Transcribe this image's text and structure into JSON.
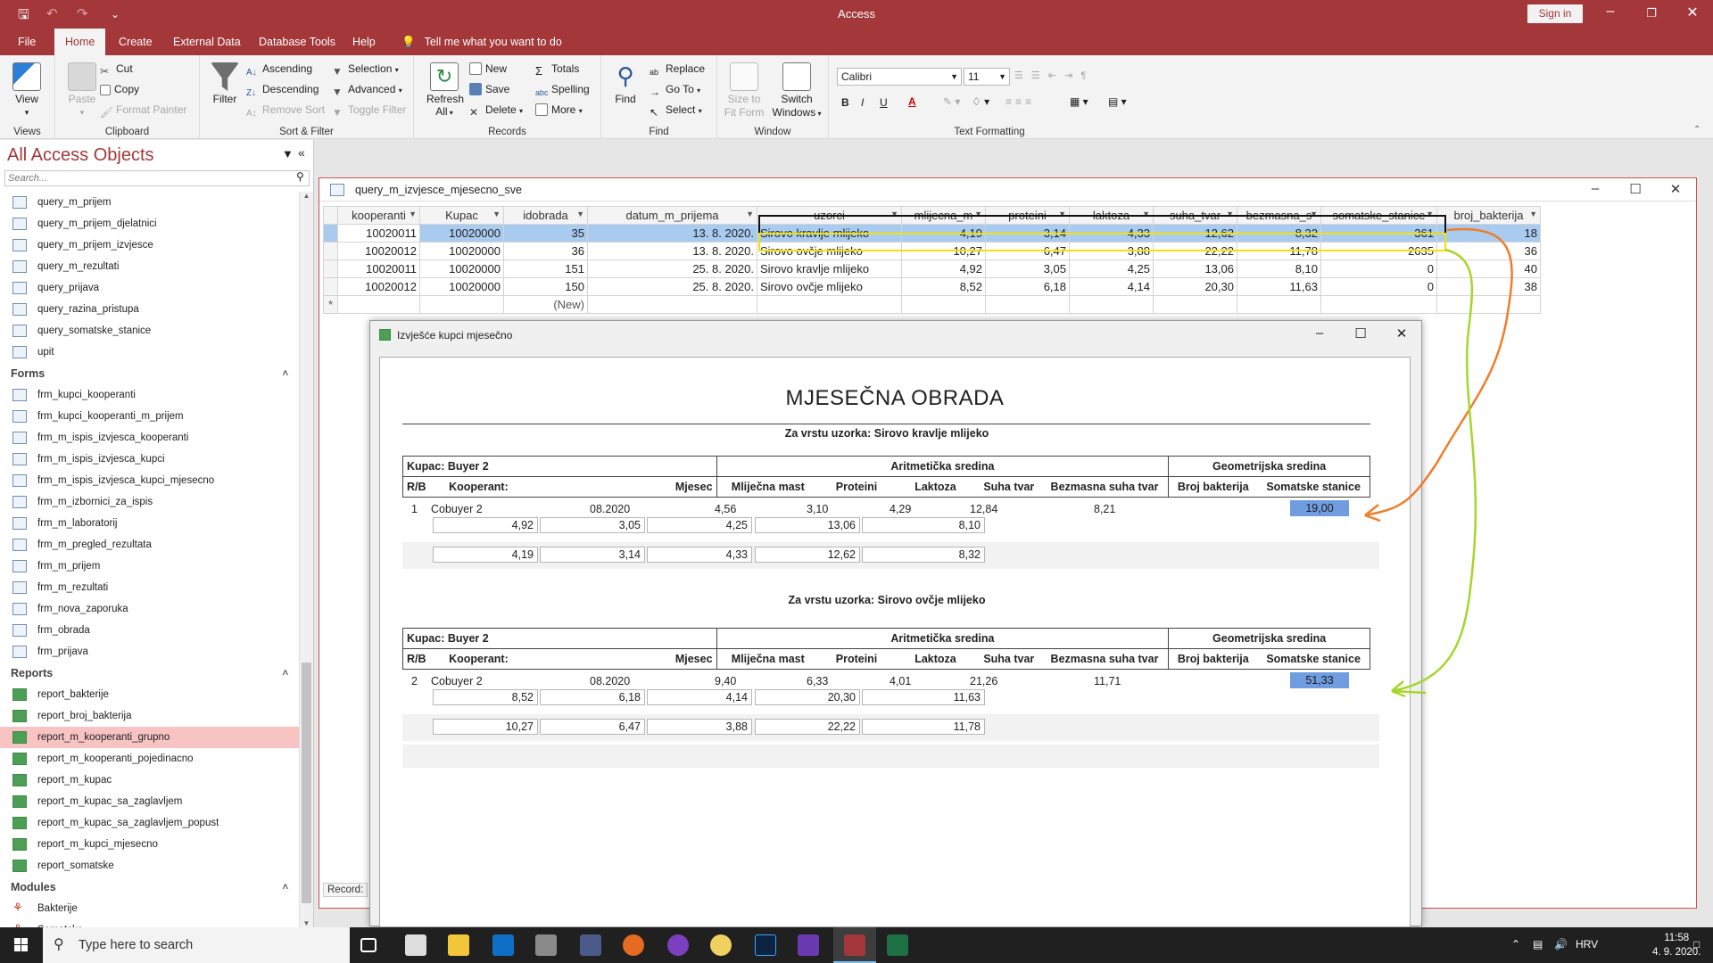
{
  "app": {
    "title": "Access",
    "signin_label": "Sign in"
  },
  "tabs": [
    "File",
    "Home",
    "Create",
    "External Data",
    "Database Tools",
    "Help"
  ],
  "tell_me": "Tell me what you want to do",
  "ribbon": {
    "views": {
      "view_label": "View",
      "group": "Views"
    },
    "clipboard": {
      "paste": "Paste",
      "cut": "Cut",
      "copy": "Copy",
      "format_painter": "Format Painter",
      "group": "Clipboard"
    },
    "sort_filter": {
      "filter": "Filter",
      "ascending": "Ascending",
      "descending": "Descending",
      "remove_sort": "Remove Sort",
      "selection": "Selection",
      "advanced": "Advanced",
      "toggle_filter": "Toggle Filter",
      "group": "Sort & Filter"
    },
    "records": {
      "refresh": "Refresh",
      "refresh_all": "All",
      "new": "New",
      "save": "Save",
      "delete": "Delete",
      "totals": "Totals",
      "spelling": "Spelling",
      "more": "More",
      "group": "Records"
    },
    "find": {
      "find": "Find",
      "replace": "Replace",
      "goto": "Go To",
      "select": "Select",
      "group": "Find"
    },
    "window": {
      "size_to_fit": "Size to",
      "size_to_fit2": "Fit Form",
      "switch": "Switch",
      "switch2": "Windows",
      "group": "Window"
    },
    "text_formatting": {
      "font": "Calibri",
      "size": "11",
      "group": "Text Formatting",
      "bold": "B",
      "italic": "I",
      "underline": "U",
      "font_color": "A"
    }
  },
  "nav": {
    "title": "All Access Objects",
    "search_placeholder": "Search...",
    "queries": [
      "query_m_prijem",
      "query_m_prijem_djelatnici",
      "query_m_prijem_izvjesce",
      "query_m_rezultati",
      "query_prijava",
      "query_razina_pristupa",
      "query_somatske_stanice",
      "upit"
    ],
    "forms_label": "Forms",
    "forms": [
      "frm_kupci_kooperanti",
      "frm_kupci_kooperanti_m_prijem",
      "frm_m_ispis_izvjesca_kooperanti",
      "frm_m_ispis_izvjesca_kupci",
      "frm_m_ispis_izvjesca_kupci_mjesecno",
      "frm_m_izbornici_za_ispis",
      "frm_m_laboratorij",
      "frm_m_pregled_rezultata",
      "frm_m_prijem",
      "frm_m_rezultati",
      "frm_nova_zaporuka",
      "frm_obrada",
      "frm_prijava"
    ],
    "reports_label": "Reports",
    "reports": [
      "report_bakterije",
      "report_broj_bakterija",
      "report_m_kooperanti_grupno",
      "report_m_kooperanti_pojedinacno",
      "report_m_kupac",
      "report_m_kupac_sa_zaglavljem",
      "report_m_kupac_sa_zaglavljem_popust",
      "report_m_kupci_mjesecno",
      "report_somatske"
    ],
    "modules_label": "Modules",
    "modules": [
      "Bakterije",
      "Somatske"
    ]
  },
  "query": {
    "title": "query_m_izvjesce_mjesecno_sve",
    "columns": [
      "kooperanti",
      "Kupac",
      "idobrada",
      "datum_m_prijema",
      "uzorci",
      "mlijecna_m",
      "proteini",
      "laktoza",
      "suha_tvar",
      "bezmasna_s",
      "somatske_stanice",
      "broj_bakterija"
    ],
    "rows": [
      [
        "10020011",
        "10020000",
        "35",
        "13. 8. 2020.",
        "Sirovo kravlje mlijeko",
        "4,19",
        "3,14",
        "4,33",
        "12,62",
        "8,32",
        "361",
        "18"
      ],
      [
        "10020012",
        "10020000",
        "36",
        "13. 8. 2020.",
        "Sirovo ovčje mlijeko",
        "10,27",
        "6,47",
        "3,88",
        "22,22",
        "11,78",
        "2635",
        "36"
      ],
      [
        "10020011",
        "10020000",
        "151",
        "25. 8. 2020.",
        "Sirovo kravlje mlijeko",
        "4,92",
        "3,05",
        "4,25",
        "13,06",
        "8,10",
        "0",
        "40"
      ],
      [
        "10020012",
        "10020000",
        "150",
        "25. 8. 2020.",
        "Sirovo ovčje mlijeko",
        "8,52",
        "6,18",
        "4,14",
        "20,30",
        "11,63",
        "0",
        "38"
      ]
    ],
    "new_row": "(New)",
    "new_marker": "*",
    "status": "Record: "
  },
  "report": {
    "window_title": "Izvješće kupci mjesečno",
    "heading": "MJESEČNA OBRADA",
    "sample_prefix": "Za vrstu uzorka:",
    "buyer_prefix": "Kupac:",
    "arith": "Aritmetička sredina",
    "geo": "Geometrijska sredina",
    "col_headers": [
      "R/B",
      "Kooperant:",
      "Mjesec",
      "Mliječna mast",
      "Proteini",
      "Laktoza",
      "Suha tvar",
      "Bezmasna suha tvar",
      "Broj bakterija",
      "Somatske stanice"
    ],
    "sections": [
      {
        "sample": "Sirovo kravlje mlijeko",
        "buyer": "Buyer 2",
        "rb": "1",
        "coop": "Cobuyer 2",
        "month": "08.2020",
        "vals": [
          "4,56",
          "3,10",
          "4,29",
          "12,84",
          "8,21"
        ],
        "somatic": "19,00",
        "detail1": [
          "4,92",
          "3,05",
          "4,25",
          "13,06",
          "8,10"
        ],
        "detail2": [
          "4,19",
          "3,14",
          "4,33",
          "12,62",
          "8,32"
        ]
      },
      {
        "sample": "Sirovo ovčje mlijeko",
        "buyer": "Buyer 2",
        "rb": "2",
        "coop": "Cobuyer 2",
        "month": "08.2020",
        "vals": [
          "9,40",
          "6,33",
          "4,01",
          "21,26",
          "11,71"
        ],
        "somatic": "51,33",
        "detail1": [
          "8,52",
          "6,18",
          "4,14",
          "20,30",
          "11,63"
        ],
        "detail2": [
          "10,27",
          "6,47",
          "3,88",
          "22,22",
          "11,78"
        ]
      }
    ]
  },
  "taskbar": {
    "search_placeholder": "Type here to search",
    "lang": "HRV",
    "time": "11:58",
    "date": "4. 9. 2020."
  },
  "colors": {
    "accent": "#a4373a",
    "highlight": "#6f9de0",
    "arrow_orange": "#f07d2a",
    "arrow_green": "#a6d62a"
  }
}
